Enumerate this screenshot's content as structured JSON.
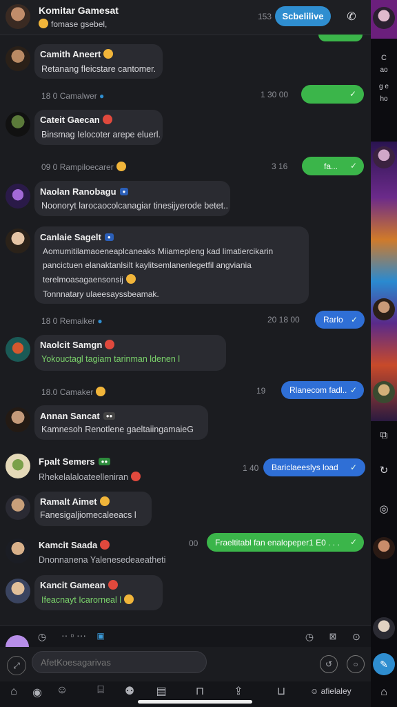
{
  "header": {
    "title": "Komitar Gamesat",
    "subtitle": "fomase gsebel,",
    "count": "153",
    "action_label": "Scbelilive"
  },
  "rail": {
    "label1": "C",
    "label2": "ao",
    "label3": "g e",
    "label4": "ho"
  },
  "messages": [
    {
      "name": "Camith Aneert",
      "text": "Retanang fleicstare cantomer.",
      "meta": "18 0 Camalwer"
    },
    {
      "name": "Cateit Gaecan",
      "text": "Binsmag Ielocoter arepe eluerl.",
      "meta": "09 0 Rampiloecarer"
    },
    {
      "name": "Naolan Ranobagu",
      "text": "Noonoryt larocaocolcanagiar tinesijyerode betet.."
    },
    {
      "name": "Canlaie Sagelt",
      "line1": "Aomumitilamaoeneaplcaneaks Miiamepleng kad limatiercikarin",
      "line2": "pancictuen elanaktanlsilt kaylitsemlanenlegetfil angviania",
      "line3": "terelmoasagaensonsij",
      "line4": "Tonnnatary ulaeesayssbeamak.",
      "meta": "18 0 Remaiker"
    },
    {
      "name": "Naolcit Samgn",
      "text": "Yokouctagl tagiam tarinman ldenen l",
      "meta": "18.0 Camaker"
    },
    {
      "name": "Annan Sancat",
      "text": "Kamnesoh Renotlene gaeltaiingamaieG"
    },
    {
      "name": "Fpalt Semers",
      "text": "Rhekelalaloateelleniran"
    },
    {
      "name": "Ramalt Aimet",
      "text": "Fanesigaljiomecaleeacs l"
    },
    {
      "name": "Kamcit Saada",
      "text": "Dnonnanena Yalenesedeaeatheti"
    },
    {
      "name": "Kancit Gamean",
      "text": "Ifeacnayt Icarorneal l"
    }
  ],
  "outgoing": [
    {
      "text": "",
      "meta": "1 30 00"
    },
    {
      "text": "fa...",
      "meta": "3 16"
    },
    {
      "text": "Rarlo",
      "meta": "20 18 00"
    },
    {
      "text": "Rlanecom fadl..",
      "meta": "19"
    },
    {
      "text": "Bariclaeeslys load",
      "meta": "1 40"
    },
    {
      "text": "Fraeltitabl fan enalopeper1 E0 . . .",
      "meta": "00"
    }
  ],
  "composer": {
    "placeholder": "AfetKoesagarivas"
  },
  "bottom_nav": {
    "label": "afielaley"
  }
}
